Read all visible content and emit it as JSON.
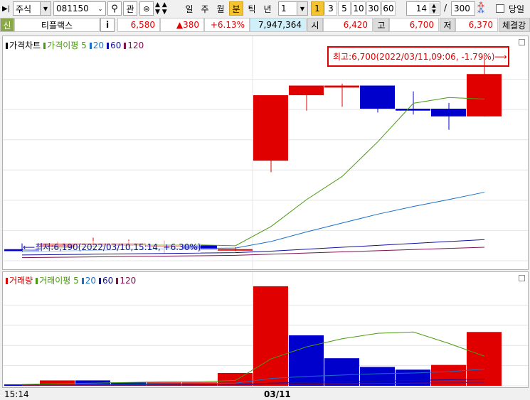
{
  "toolbar": {
    "market": "주식",
    "code": "081150",
    "gwan": "관",
    "periods": [
      {
        "label": "일",
        "active": false
      },
      {
        "label": "주",
        "active": false
      },
      {
        "label": "월",
        "active": false
      },
      {
        "label": "분",
        "active": true
      },
      {
        "label": "틱",
        "active": false
      },
      {
        "label": "년",
        "active": false
      }
    ],
    "interval_select": "1",
    "interval_buttons": [
      {
        "label": "1",
        "active": true
      },
      {
        "label": "3",
        "active": false
      },
      {
        "label": "5",
        "active": false
      },
      {
        "label": "10",
        "active": false
      },
      {
        "label": "30",
        "active": false
      },
      {
        "label": "60",
        "active": false
      }
    ],
    "view_count": "14",
    "slash": "/",
    "total_count": "300",
    "today_label": "당일"
  },
  "info_bar": {
    "credit": "신",
    "name": "티플랙스",
    "info_button": "i",
    "price": "6,580",
    "change": "▲380",
    "change_pct": "+6.13%",
    "volume": "7,947,364",
    "open_label": "시",
    "open": "6,420",
    "high_label": "고",
    "high": "6,700",
    "low_label": "저",
    "low": "6,370",
    "trade_label": "체결강"
  },
  "colors": {
    "up": "#e00000",
    "down": "#0000cc",
    "ma5": "#4a9a10",
    "ma20": "#1a70c8",
    "ma60": "#1010a0",
    "ma120": "#801050"
  },
  "chart_data": [
    {
      "type": "candlestick",
      "legend": [
        {
          "name": "가격차트",
          "color": "#000000"
        },
        {
          "name": "가격이평 5",
          "color": "#4a9a10"
        },
        {
          "name": "20",
          "color": "#1a70c8"
        },
        {
          "name": "60",
          "color": "#1010a0"
        },
        {
          "name": "120",
          "color": "#801050"
        }
      ],
      "ylim": [
        6170,
        6720
      ],
      "candles": [
        {
          "o": 6200,
          "h": 6215,
          "l": 6195,
          "c": 6195
        },
        {
          "o": 6205,
          "h": 6220,
          "l": 6200,
          "c": 6215
        },
        {
          "o": 6215,
          "h": 6230,
          "l": 6205,
          "c": 6215
        },
        {
          "o": 6215,
          "h": 6225,
          "l": 6205,
          "c": 6215
        },
        {
          "o": 6210,
          "h": 6222,
          "l": 6190,
          "c": 6210
        },
        {
          "o": 6210,
          "h": 6215,
          "l": 6195,
          "c": 6200
        },
        {
          "o": 6200,
          "h": 6205,
          "l": 6195,
          "c": 6200
        },
        {
          "o": 6430,
          "h": 6580,
          "l": 6400,
          "c": 6600
        },
        {
          "o": 6600,
          "h": 6625,
          "l": 6560,
          "c": 6625
        },
        {
          "o": 6620,
          "h": 6630,
          "l": 6570,
          "c": 6625
        },
        {
          "o": 6625,
          "h": 6625,
          "l": 6555,
          "c": 6565
        },
        {
          "o": 6565,
          "h": 6610,
          "l": 6550,
          "c": 6560
        },
        {
          "o": 6565,
          "h": 6580,
          "l": 6510,
          "c": 6545
        },
        {
          "o": 6545,
          "h": 6700,
          "l": 6545,
          "c": 6655
        }
      ],
      "ma5": [
        6197,
        6203,
        6208,
        6210,
        6212,
        6211,
        6209,
        6259,
        6329,
        6389,
        6479,
        6579,
        6594,
        6590
      ],
      "ma20": [
        6193,
        6195,
        6197,
        6199,
        6201,
        6202,
        6203,
        6220,
        6245,
        6268,
        6291,
        6311,
        6329,
        6348
      ],
      "ma60": [
        6185,
        6186,
        6187,
        6188,
        6189,
        6190,
        6191,
        6195,
        6200,
        6205,
        6210,
        6215,
        6220,
        6225
      ],
      "ma120": [
        6178,
        6179,
        6180,
        6181,
        6182,
        6183,
        6184,
        6187,
        6190,
        6193,
        6196,
        6199,
        6202,
        6205
      ],
      "max_annotation": "최고:6,700(2022/03/11,09:06, -1.79%)⟶",
      "min_annotation": "⟵최저:6,190(2022/03/10,15:14, +6.30%)"
    },
    {
      "type": "bar",
      "legend": [
        {
          "name": "거래량",
          "color": "#e00000"
        },
        {
          "name": "거래이평 5",
          "color": "#4a9a10"
        },
        {
          "name": "20",
          "color": "#1a70c8"
        },
        {
          "name": "60",
          "color": "#1010a0"
        },
        {
          "name": "120",
          "color": "#801050"
        }
      ],
      "ylim": [
        0,
        150
      ],
      "volumes": [
        2,
        8,
        8,
        5,
        5,
        5,
        19,
        148,
        75,
        41,
        28,
        24,
        31,
        80
      ],
      "up": [
        false,
        true,
        false,
        false,
        true,
        true,
        true,
        true,
        false,
        false,
        false,
        false,
        true,
        true
      ],
      "ma5": [
        2,
        3,
        4,
        5,
        6,
        6,
        8,
        40,
        58,
        70,
        78,
        80,
        63,
        44
      ],
      "ma20": [
        1,
        1.5,
        2,
        2.5,
        3,
        3.5,
        4,
        11,
        14,
        16,
        18,
        19,
        21,
        25
      ],
      "ma60": [
        1,
        1,
        1.2,
        1.3,
        1.4,
        1.5,
        2,
        4,
        5,
        6,
        7,
        8,
        9,
        10
      ],
      "ma120": [
        0.5,
        0.5,
        0.6,
        0.7,
        0.8,
        0.9,
        1,
        2,
        2.5,
        3,
        3.5,
        4,
        4.5,
        5
      ]
    }
  ],
  "x_axis": {
    "left_label": "15:14",
    "center_label": "03/11"
  }
}
